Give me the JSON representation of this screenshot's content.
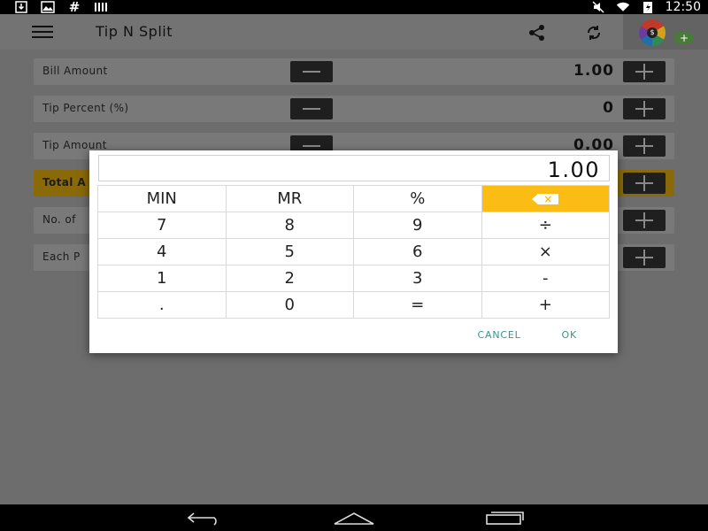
{
  "status_bar": {
    "left_icons": [
      "download-icon",
      "image-icon",
      "hash-icon",
      "signal-bars-icon"
    ],
    "right_icons": [
      "mute-icon",
      "wifi-icon",
      "battery-charging-icon"
    ],
    "time": "12:50"
  },
  "toolbar": {
    "title": "Tip N Split",
    "icons": [
      "menu-icon",
      "share-icon",
      "refresh-icon",
      "app-logo-icon"
    ],
    "logo_center": "$",
    "logo_plus": "+"
  },
  "rows": {
    "bill": {
      "label": "Bill Amount",
      "value": "1.00"
    },
    "tip_percent": {
      "label": "Tip Percent (%)",
      "value": "0"
    },
    "tip_amount": {
      "label": "Tip Amount",
      "value": "0.00"
    },
    "total": {
      "label": "Total A"
    },
    "people": {
      "label": "No. of"
    },
    "each": {
      "label": "Each P"
    }
  },
  "dialog": {
    "display": "1.00",
    "keys": {
      "min": "MIN",
      "mr": "MR",
      "percent": "%",
      "k7": "7",
      "k8": "8",
      "k9": "9",
      "divide": "÷",
      "k4": "4",
      "k5": "5",
      "k6": "6",
      "multiply": "×",
      "k1": "1",
      "k2": "2",
      "k3": "3",
      "minus": "-",
      "dot": ".",
      "k0": "0",
      "equals": "=",
      "plus": "+"
    },
    "backspace_icon": "backspace-icon",
    "backspace_x": "×",
    "cancel": "CANCEL",
    "ok": "OK"
  },
  "colors": {
    "accent": "#fbbd14",
    "dialog_action": "#2f9a8a",
    "dim_background": "#6d6d6d"
  },
  "nav_bar": {
    "icons": [
      "back-icon",
      "home-icon",
      "recents-icon"
    ]
  }
}
